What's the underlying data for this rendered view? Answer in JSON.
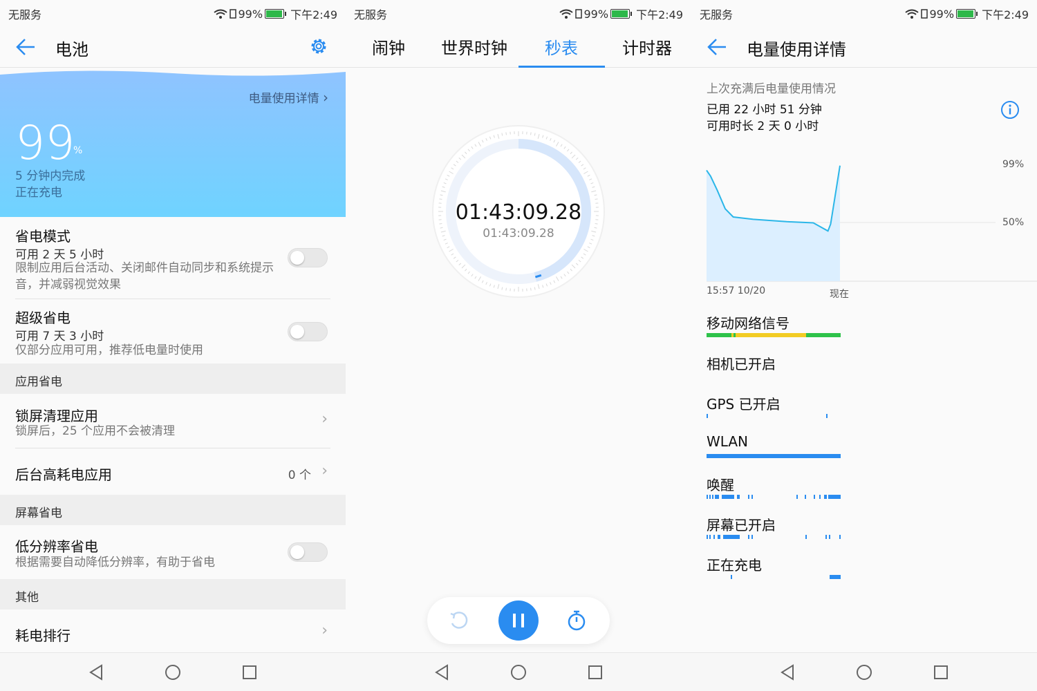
{
  "status": {
    "carrier": "无服务",
    "battery": "99%",
    "time": "下午2:49"
  },
  "battery_screen": {
    "title": "电池",
    "detail_link": "电量使用详情",
    "percent": "99",
    "percent_sign": "%",
    "finish_text": "5 分钟内完成",
    "charging_text": "正在充电",
    "power_saving": {
      "title": "省电模式",
      "available": "可用 2 天 5 小时",
      "desc": "限制应用后台活动、关闭邮件自动同步和系统提示音，并减弱视觉效果",
      "enabled": false
    },
    "ultra_saving": {
      "title": "超级省电",
      "available": "可用 7 天 3 小时",
      "desc": "仅部分应用可用，推荐低电量时使用",
      "enabled": false
    },
    "section_app": "应用省电",
    "lock_clean": {
      "title": "锁屏清理应用",
      "desc": "锁屏后，25 个应用不会被清理"
    },
    "bg_high": {
      "title": "后台高耗电应用",
      "count": "0 个"
    },
    "section_screen": "屏幕省电",
    "low_res": {
      "title": "低分辨率省电",
      "desc": "根据需要自动降低分辨率，有助于省电",
      "enabled": false
    },
    "section_other": "其他",
    "ranking": {
      "title": "耗电排行"
    }
  },
  "stopwatch_screen": {
    "tabs": [
      "闹钟",
      "世界时钟",
      "秒表",
      "计时器"
    ],
    "active_tab": 2,
    "time_main": "01:43:09.28",
    "time_lap": "01:43:09.28",
    "dial_progress": 0.46
  },
  "usage_screen": {
    "title": "电量使用详情",
    "heading": "上次充满后电量使用情况",
    "used": "已用 22 小时 51 分钟",
    "available": "可用时长 2 天 0 小时",
    "chart_data": {
      "type": "area",
      "y_ticks": [
        "99%",
        "50%"
      ],
      "x_labels": [
        "15:57  10/20",
        "现在"
      ],
      "points": [
        [
          0,
          95
        ],
        [
          3,
          90
        ],
        [
          8,
          78
        ],
        [
          14,
          62
        ],
        [
          20,
          55
        ],
        [
          35,
          53
        ],
        [
          60,
          51
        ],
        [
          80,
          50
        ],
        [
          91,
          43
        ],
        [
          93,
          49
        ],
        [
          100,
          99
        ]
      ]
    },
    "tracks": [
      {
        "label": "移动网络信号",
        "color": "#2ec24a"
      },
      {
        "label": "相机已开启",
        "color": ""
      },
      {
        "label": "GPS 已开启",
        "color": "#2a8cf0"
      },
      {
        "label": "WLAN",
        "color": "#2a8cf0"
      },
      {
        "label": "唤醒",
        "color": "#2a8cf0"
      },
      {
        "label": "屏幕已开启",
        "color": "#2a8cf0"
      },
      {
        "label": "正在充电",
        "color": "#2a8cf0"
      }
    ]
  },
  "colors": {
    "accent": "#2a8cf0",
    "signal_good": "#2ec24a",
    "signal_mid": "#f2cc24"
  }
}
